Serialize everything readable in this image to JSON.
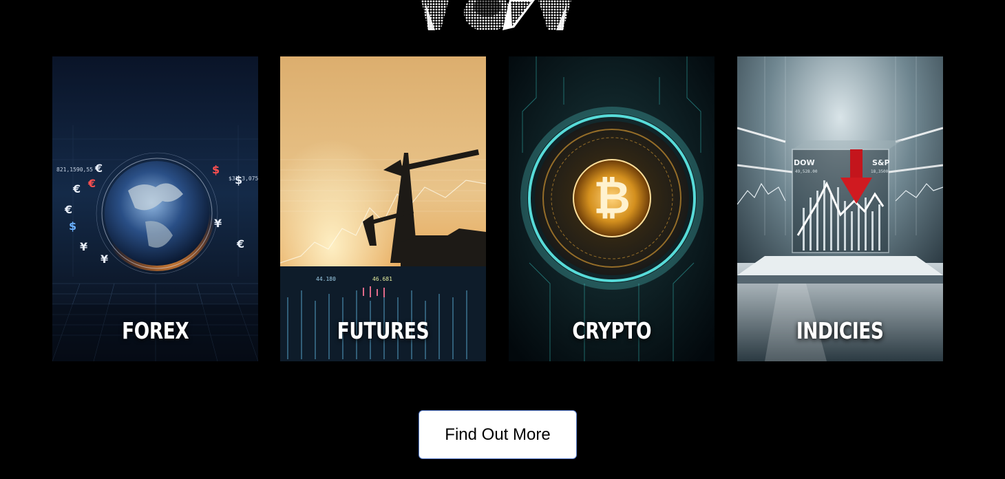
{
  "cards": [
    {
      "label": "FOREX",
      "icon": "globe-currency-image"
    },
    {
      "label": "FUTURES",
      "icon": "oil-pump-image"
    },
    {
      "label": "CRYPTO",
      "icon": "bitcoin-image"
    },
    {
      "label": "INDICIES",
      "icon": "index-chart-image"
    }
  ],
  "forex_art": {
    "t1": "821,1590,55",
    "t2": "$31,3,075"
  },
  "futures_art": {
    "t1": "44.180",
    "t2": "46.681"
  },
  "indices_art": {
    "t1": "DOW",
    "t2": "S&P",
    "t3": "49,528.00",
    "t4": "18,3500"
  },
  "cta": {
    "label": "Find Out More"
  },
  "colors": {
    "background": "#000000",
    "button_bg": "#ffffff",
    "button_border": "#5a7fcf"
  }
}
